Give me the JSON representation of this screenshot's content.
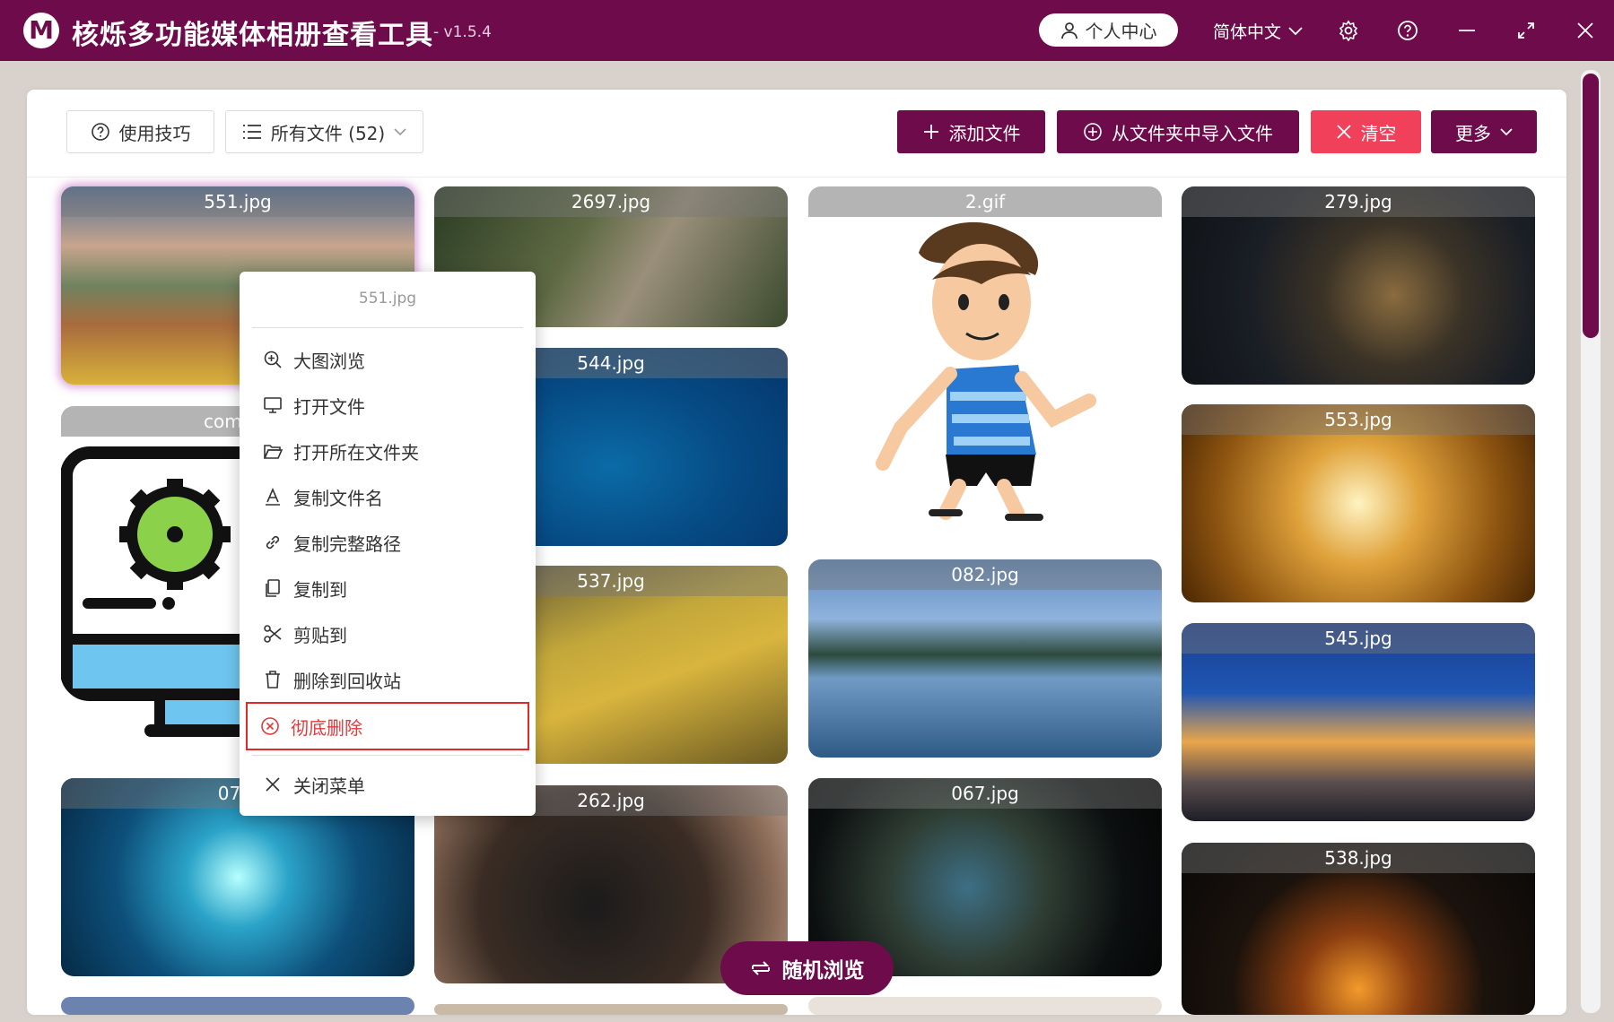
{
  "app": {
    "title": "核烁多功能媒体相册查看工具",
    "version": "- v1.5.4",
    "logo_letter": "M",
    "user_center": "个人中心",
    "language": "简体中文"
  },
  "toolbar": {
    "tips_label": "使用技巧",
    "filter_label": "所有文件 (52)",
    "add_files_label": "添加文件",
    "import_folder_label": "从文件夹中导入文件",
    "clear_label": "清空",
    "more_label": "更多"
  },
  "cards": [
    {
      "name": "551.jpg"
    },
    {
      "name": "2697.jpg"
    },
    {
      "name": "2.gif"
    },
    {
      "name": "279.jpg"
    },
    {
      "name": "544.jpg"
    },
    {
      "name": "comput"
    },
    {
      "name": "553.jpg"
    },
    {
      "name": "537.jpg"
    },
    {
      "name": "082.jpg"
    },
    {
      "name": "545.jpg"
    },
    {
      "name": "074."
    },
    {
      "name": "262.jpg"
    },
    {
      "name": "067.jpg"
    },
    {
      "name": "538.jpg"
    }
  ],
  "context_menu": {
    "title": "551.jpg",
    "items": [
      {
        "label": "大图浏览",
        "icon": "zoom-in-icon"
      },
      {
        "label": "打开文件",
        "icon": "monitor-icon"
      },
      {
        "label": "打开所在文件夹",
        "icon": "folder-open-icon"
      },
      {
        "label": "复制文件名",
        "icon": "text-a-icon"
      },
      {
        "label": "复制完整路径",
        "icon": "link-icon"
      },
      {
        "label": "复制到",
        "icon": "copy-icon"
      },
      {
        "label": "剪贴到",
        "icon": "scissors-icon"
      },
      {
        "label": "删除到回收站",
        "icon": "trash-icon"
      },
      {
        "label": "彻底删除",
        "icon": "close-circle-icon"
      },
      {
        "label": "关闭菜单",
        "icon": "close-icon"
      }
    ]
  },
  "random_browse_label": "随机浏览",
  "colors": {
    "brand": "#6e0b4b",
    "danger": "#f0405a",
    "danger_text": "#e03a3a"
  }
}
